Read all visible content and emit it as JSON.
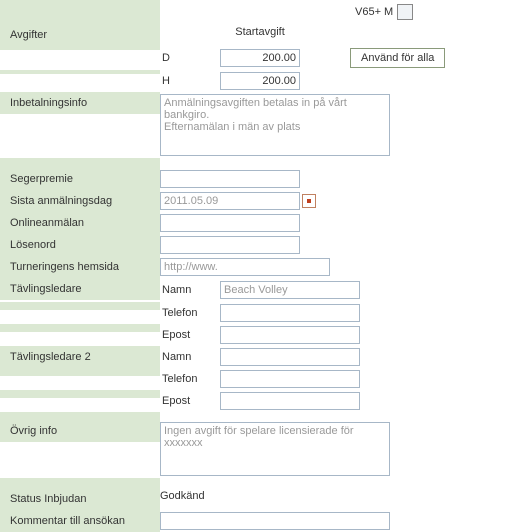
{
  "top": {
    "class_label": "V65+ M"
  },
  "labels": {
    "avgifter": "Avgifter",
    "startavgift": "Startavgift",
    "d": "D",
    "h": "H",
    "use_all": "Använd för alla",
    "inbetalningsinfo": "Inbetalningsinfo",
    "segerpremie": "Segerpremie",
    "sista": "Sista anmälningsdag",
    "onlineanmalan": "Onlineanmälan",
    "losenord": "Lösenord",
    "hemsida": "Turneringens hemsida",
    "tavlingsledare": "Tävlingsledare",
    "tavlingsledare2": "Tävlingsledare 2",
    "namn": "Namn",
    "telefon": "Telefon",
    "epost": "Epost",
    "ovrig": "Övrig info",
    "status": "Status Inbjudan",
    "kommentar": "Kommentar till ansökan"
  },
  "values": {
    "fee_d": "200.00",
    "fee_h": "200.00",
    "payment_info": "Anmälningsavgiften betalas in på vårt bankgiro.\nEfternamälan i män av plats",
    "sista_date": "2011.05.09",
    "hemsida_ph": "http://www.",
    "ledare1_namn_ph": "Beach Volley",
    "ovrig_info": "Ingen avgift för spelare licensierade för xxxxxxx",
    "status_val": "Godkänd"
  }
}
